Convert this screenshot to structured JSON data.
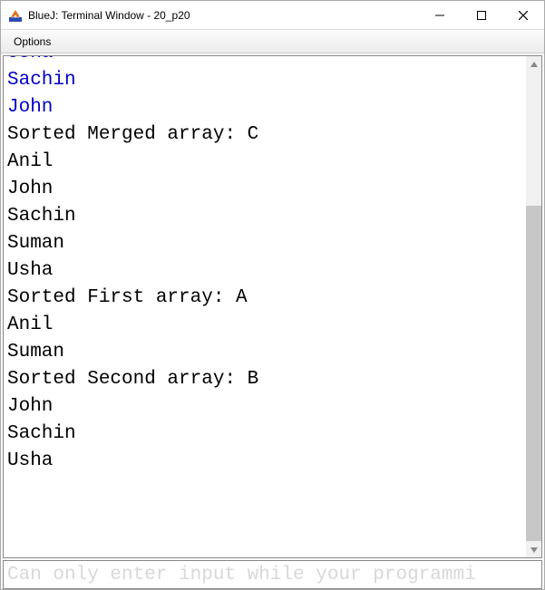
{
  "window": {
    "title": "BlueJ: Terminal Window - 20_p20"
  },
  "menubar": {
    "options": "Options"
  },
  "terminal": {
    "lines": [
      {
        "text": "Usha",
        "type": "input",
        "cut": true
      },
      {
        "text": "Sachin",
        "type": "input"
      },
      {
        "text": "John",
        "type": "input"
      },
      {
        "text": "Sorted Merged array: C",
        "type": "output"
      },
      {
        "text": "Anil",
        "type": "output"
      },
      {
        "text": "John",
        "type": "output"
      },
      {
        "text": "Sachin",
        "type": "output"
      },
      {
        "text": "Suman",
        "type": "output"
      },
      {
        "text": "Usha",
        "type": "output"
      },
      {
        "text": "Sorted First array: A",
        "type": "output"
      },
      {
        "text": "Anil",
        "type": "output"
      },
      {
        "text": "Suman",
        "type": "output"
      },
      {
        "text": "Sorted Second array: B",
        "type": "output"
      },
      {
        "text": "John",
        "type": "output"
      },
      {
        "text": "Sachin",
        "type": "output"
      },
      {
        "text": "Usha",
        "type": "output"
      },
      {
        "text": " ",
        "type": "output"
      },
      {
        "text": " ",
        "type": "output"
      }
    ]
  },
  "input": {
    "placeholder": "Can only enter input while your programmi"
  }
}
